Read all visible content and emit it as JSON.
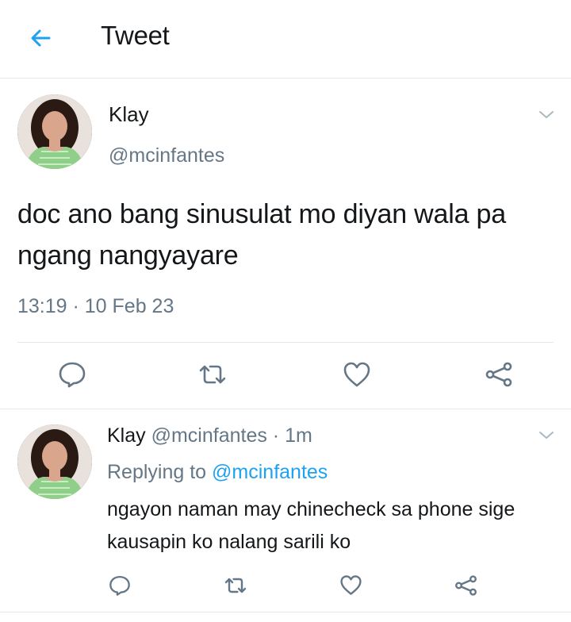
{
  "header": {
    "title": "Tweet",
    "back_icon": "arrow-left-icon",
    "accent_color": "#1da1f2"
  },
  "main_tweet": {
    "name": "Klay",
    "handle": "@mcinfantes",
    "text": "doc ano bang sinusulat mo diyan wala pa ngang nangyayare",
    "timestamp": "13:19 · 10 Feb 23",
    "menu_icon": "chevron-down-icon",
    "actions": [
      "reply-icon",
      "retweet-icon",
      "like-icon",
      "share-icon"
    ]
  },
  "reply_tweet": {
    "name": "Klay",
    "handle_time": "@mcinfantes · 1m",
    "replying_prefix": "Replying to",
    "replying_to": "@mcinfantes",
    "text": "ngayon naman may chinecheck sa phone sige kausapin ko nalang sarili ko",
    "menu_icon": "chevron-down-icon",
    "actions": [
      "reply-icon",
      "retweet-icon",
      "like-icon",
      "share-icon"
    ]
  },
  "colors": {
    "text_primary": "#14171a",
    "text_secondary": "#657786",
    "border": "#e1e8ed",
    "link": "#1da1f2"
  }
}
